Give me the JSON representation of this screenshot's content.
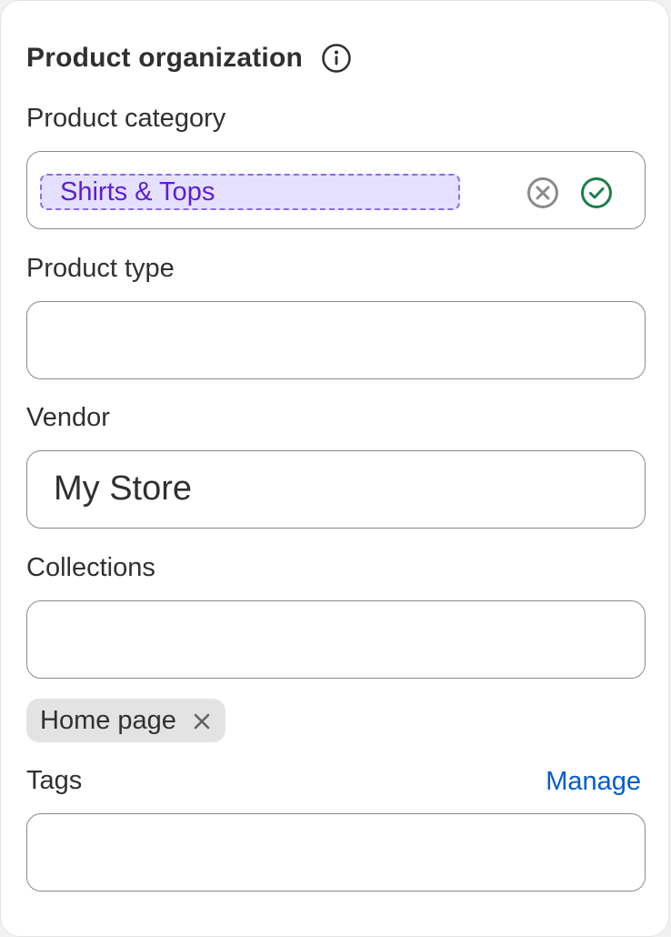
{
  "section": {
    "title": "Product organization"
  },
  "category": {
    "label": "Product category",
    "value": "Shirts & Tops"
  },
  "product_type": {
    "label": "Product type",
    "value": ""
  },
  "vendor": {
    "label": "Vendor",
    "value": "My Store"
  },
  "collections": {
    "label": "Collections",
    "value": "",
    "selected": [
      "Home page"
    ]
  },
  "tags": {
    "label": "Tags",
    "manage_label": "Manage",
    "value": ""
  },
  "colors": {
    "accent_link": "#005bd3",
    "suggestion_bg": "#e5e0ff",
    "suggestion_text": "#5b1fd6",
    "success": "#1a7f4b"
  },
  "icons": {
    "info": "info-circle-icon",
    "clear": "x-circle-icon",
    "accept": "check-circle-icon",
    "remove": "x-icon"
  }
}
